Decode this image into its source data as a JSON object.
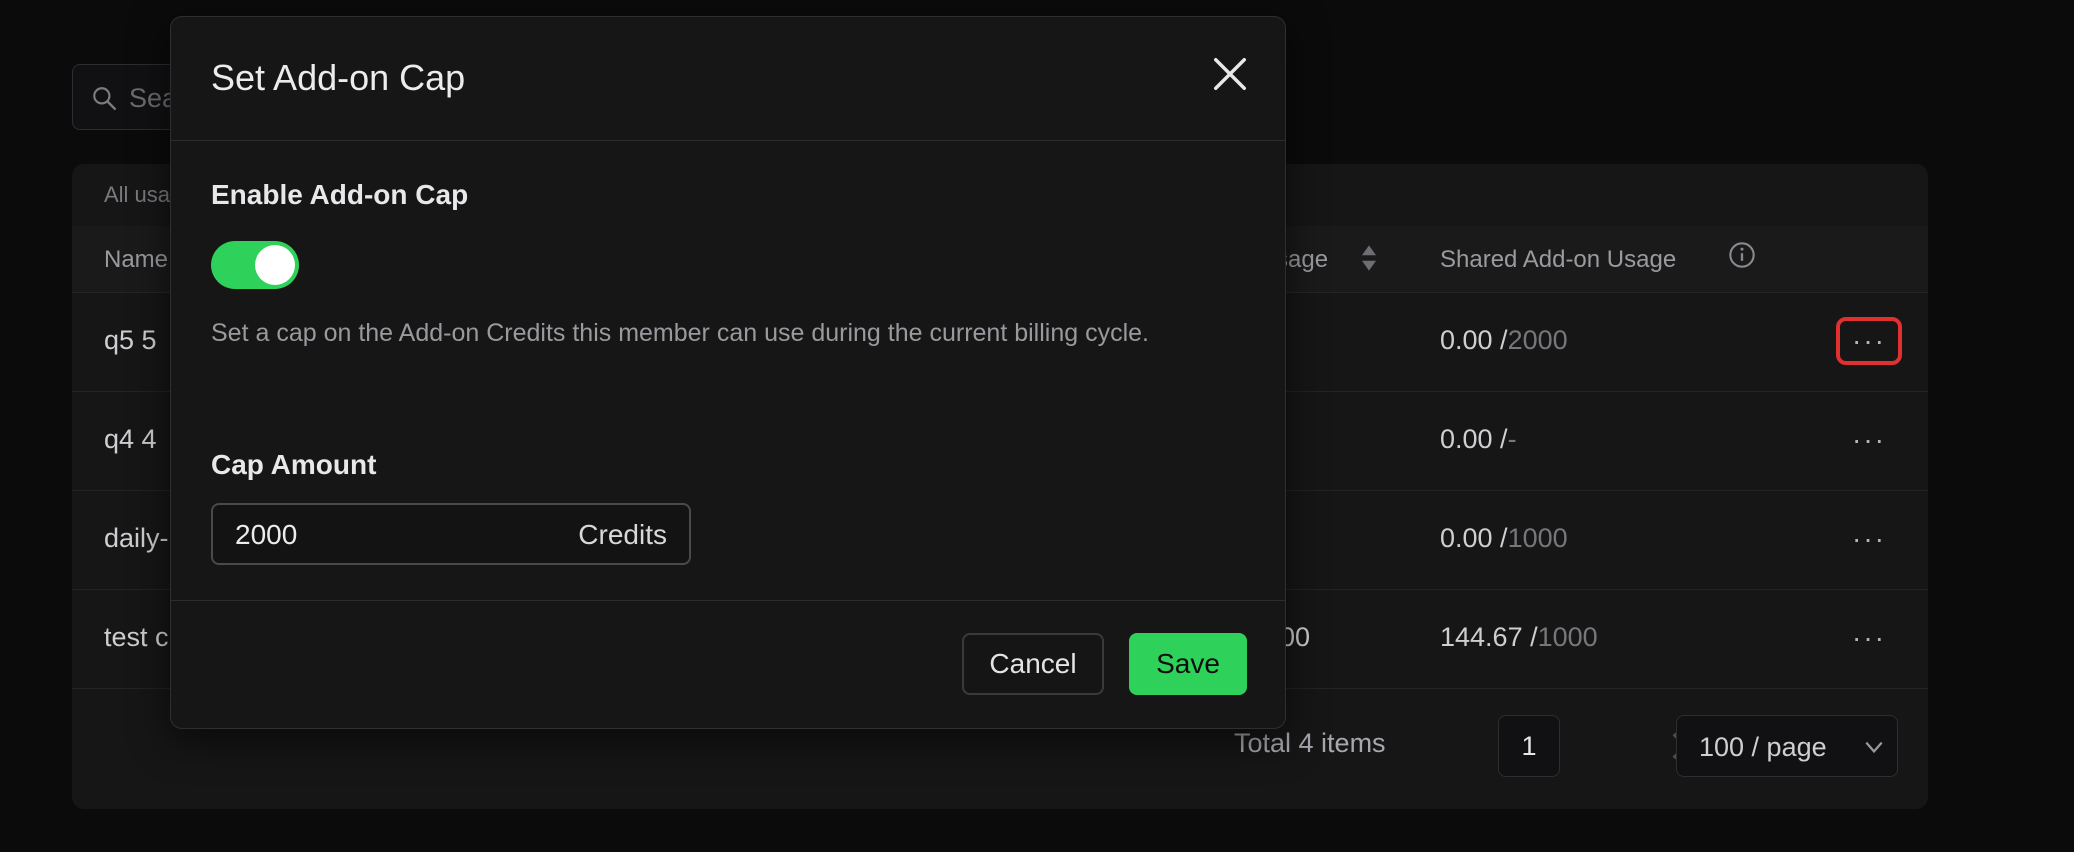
{
  "search": {
    "placeholder": "Sea"
  },
  "table": {
    "caption": "All usa",
    "columns": {
      "name": "Name",
      "usage": "sage",
      "shared_usage": "Shared Add-on Usage"
    },
    "rows": [
      {
        "name": "q5 5",
        "usage": "",
        "shared_used": "0.00 /",
        "shared_cap": "2000"
      },
      {
        "name": "q4 4",
        "usage": "",
        "shared_used": "0.00 /",
        "shared_cap": "-"
      },
      {
        "name": "daily-",
        "usage": "",
        "shared_used": "0.00 /",
        "shared_cap": "1000"
      },
      {
        "name": "test c",
        "usage": "00",
        "shared_used": "144.67 /",
        "shared_cap": "1000"
      }
    ],
    "more_label": "···"
  },
  "pagination": {
    "total": "Total 4 items",
    "current_page": "1",
    "page_size": "100 / page"
  },
  "modal": {
    "title": "Set Add-on Cap",
    "enable_label": "Enable Add-on Cap",
    "toggle_on": true,
    "help_text": "Set a cap on the Add-on Credits this member can use during the current billing cycle.",
    "cap_label": "Cap Amount",
    "cap_value": "2000",
    "cap_unit": "Credits",
    "cancel_label": "Cancel",
    "save_label": "Save"
  },
  "colors": {
    "accent_green": "#2ed159",
    "highlight_red": "#e03030",
    "background": "#0b0b0c"
  },
  "icons": [
    "search-icon",
    "sort-icon",
    "info-icon",
    "more-icon",
    "close-icon",
    "chevron-left-icon",
    "chevron-right-icon",
    "chevron-down-icon"
  ]
}
